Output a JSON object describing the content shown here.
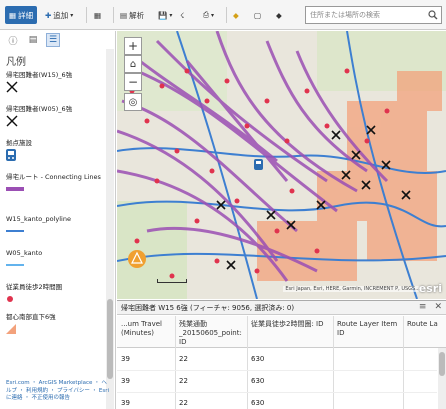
{
  "toolbar": {
    "details_label": "詳細",
    "add_label": "追加",
    "analysis_label": "解析",
    "search_placeholder": "住所または場所の検索"
  },
  "sidebar": {
    "legend_title": "凡例",
    "legend_items": [
      {
        "label": "帰宅困難者(W15)_6強",
        "symbol": "cross"
      },
      {
        "label": "帰宅困難者(W05)_6強",
        "symbol": "cross"
      },
      {
        "label": "拠点施設",
        "symbol": "bus"
      },
      {
        "label": "帰宅ルート - Connecting Lines",
        "symbol": "purple-line"
      },
      {
        "label": "W15_kanto_polyline",
        "symbol": "blue-line"
      },
      {
        "label": "W05_kanto",
        "symbol": "lightblue-line"
      },
      {
        "label": "従業員徒歩2時間圏",
        "symbol": "red-dot"
      },
      {
        "label": "都心南部直下6強",
        "symbol": "orange-tri"
      }
    ],
    "footer": "Esri.com ・ ArcGIS Marketplace ・ ヘルプ ・ 利用規約 ・ プライバシー ・ Esri に連絡 ・ 不正使用の報告"
  },
  "map": {
    "attribution": "Esri Japan, Esri, HERE, Garmin, INCREMENT P, USGS..."
  },
  "table": {
    "title": "帰宅困難者 W15 6強 (フィーチャ: 9056, 選択済み: 0)",
    "columns": [
      "...um Travel (Minutes)",
      "残業通勤_20150605_point: ID",
      "従業員徒歩2時間圏: ID",
      "Route Layer Item ID",
      "Route La"
    ],
    "rows": [
      [
        "39",
        "22",
        "630",
        "",
        ""
      ],
      [
        "39",
        "22",
        "630",
        "",
        ""
      ],
      [
        "39",
        "22",
        "630",
        "",
        ""
      ]
    ]
  },
  "colors": {
    "accent": "#2b6cb0",
    "route": "#9b4fb4",
    "river": "#3d7fd1",
    "dots": "#e0334e",
    "risk": "#f3a27c"
  }
}
